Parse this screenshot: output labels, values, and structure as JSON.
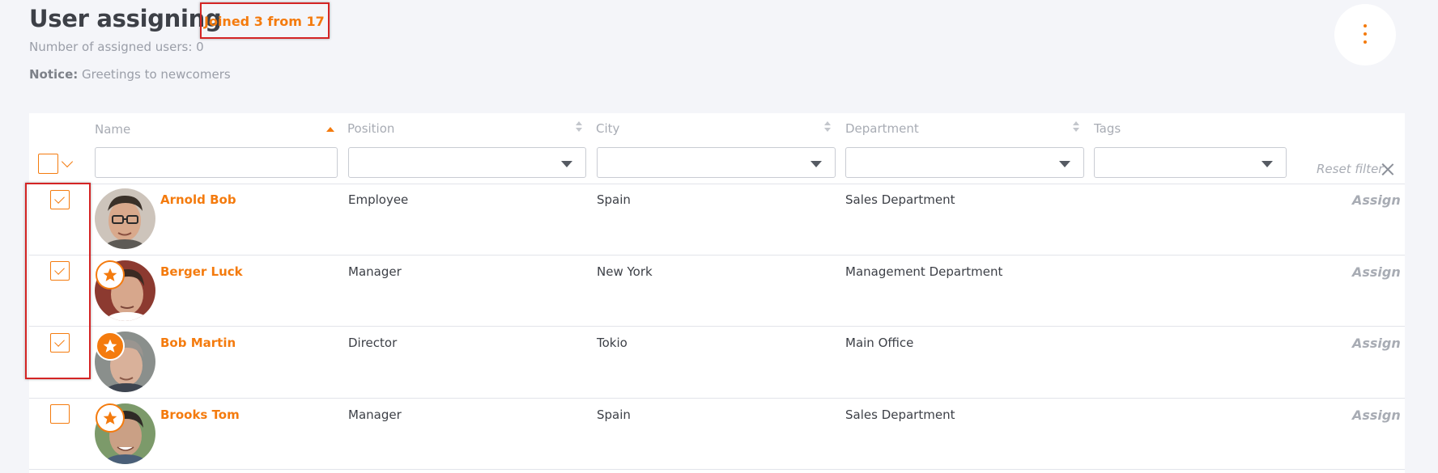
{
  "header": {
    "title": "User assigning",
    "joined_text": "Joined 3 from 17",
    "assigned_count_text": "Number of assigned users: 0",
    "notice_label": "Notice:",
    "notice_text": "Greetings to newcomers",
    "more_icon": "more-vertical-icon"
  },
  "table": {
    "columns": {
      "name": "Name",
      "position": "Position",
      "city": "City",
      "department": "Department",
      "tags": "Tags"
    },
    "reset_filter": "Reset filter",
    "assign_label": "Assign",
    "rows": [
      {
        "name": "Arnold Bob",
        "position": "Employee",
        "city": "Spain",
        "department": "Sales Department",
        "checked": true,
        "badge": "none"
      },
      {
        "name": "Berger Luck",
        "position": "Manager",
        "city": "New York",
        "department": "Management Department",
        "checked": true,
        "badge": "outline-star"
      },
      {
        "name": "Bob Martin",
        "position": "Director",
        "city": "Tokio",
        "department": "Main Office",
        "checked": true,
        "badge": "filled-star"
      },
      {
        "name": "Brooks Tom",
        "position": "Manager",
        "city": "Spain",
        "department": "Sales Department",
        "checked": false,
        "badge": "outline-star"
      }
    ]
  },
  "colors": {
    "accent": "#f47b0e",
    "highlight": "#d42424",
    "muted_text": "#a8acb4",
    "body_text": "#3d4047"
  }
}
